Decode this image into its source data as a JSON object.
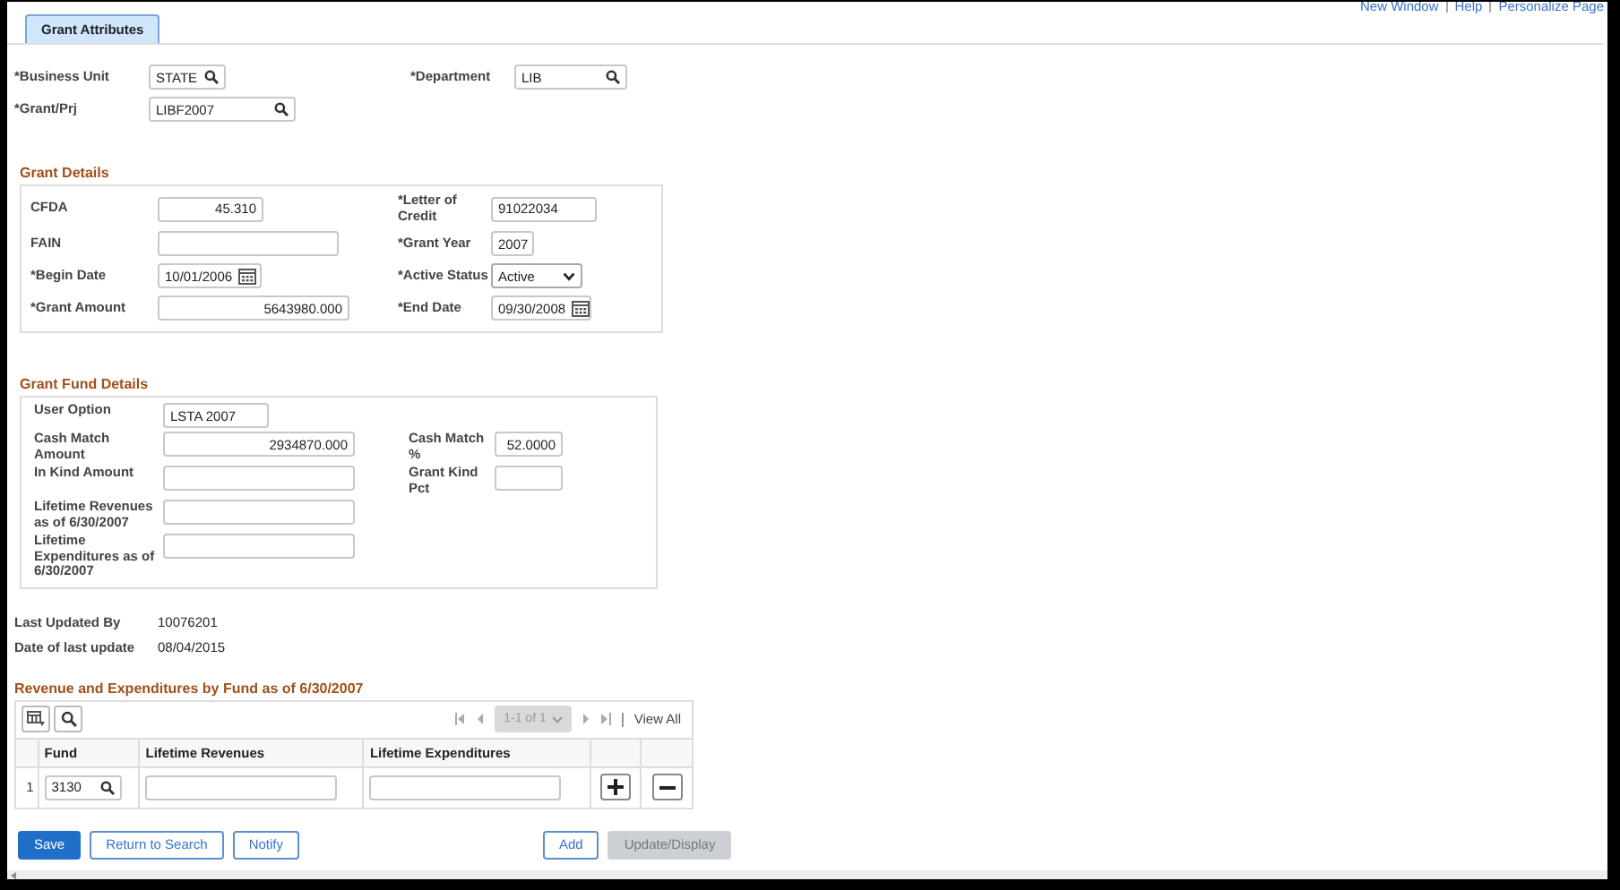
{
  "links": [
    "New Window",
    "Help",
    "Personalize Page"
  ],
  "tabs": [
    {
      "label": "Grant Attributes",
      "selected": true
    }
  ],
  "header_fields": [
    {
      "label": "*Business Unit",
      "value": "STATE",
      "kind": "lookup"
    },
    {
      "label": "*Department",
      "value": "LIB",
      "kind": "lookup"
    },
    {
      "label": "*Grant/Prj",
      "value": "LIBF2007",
      "kind": "lookup"
    }
  ],
  "grant_details": {
    "title": "Grant Details",
    "rows": [
      {
        "left": {
          "label": "CFDA",
          "value": "45.310",
          "kind": "number"
        },
        "right": {
          "label": "*Letter of Credit",
          "value": "91022034",
          "kind": "text"
        }
      },
      {
        "left": {
          "label": "FAIN",
          "kind": "text"
        },
        "right": {
          "label": "*Grant Year",
          "value": "2007",
          "kind": "number"
        }
      },
      {
        "left": {
          "label": "*Begin Date",
          "value": "10/01/2006",
          "kind": "date"
        },
        "right": {
          "label": "*Active Status",
          "value": "Active",
          "kind": "select"
        }
      },
      {
        "left": {
          "label": "*Grant Amount",
          "value": "5643980.000",
          "kind": "number"
        },
        "right": {
          "label": "*End Date",
          "value": "09/30/2008",
          "kind": "date"
        }
      }
    ]
  },
  "grant_fund_details": {
    "title": "Grant Fund Details",
    "rows": [
      {
        "left": {
          "label": "User Option",
          "value": "LSTA 2007",
          "kind": "text"
        }
      },
      {
        "left": {
          "label": "Cash Match Amount",
          "value": "2934870.000",
          "kind": "number"
        },
        "right": {
          "label": "Cash Match %",
          "value": "52.0000",
          "kind": "number"
        }
      },
      {
        "left": {
          "label": "In Kind Amount",
          "kind": "number"
        },
        "right": {
          "label": "Grant Kind Pct",
          "kind": "number"
        }
      },
      {
        "left": {
          "label": "Lifetime Revenues as of 6/30/2007",
          "kind": "number"
        }
      },
      {
        "left": {
          "label": "Lifetime Expenditures as of 6/30/2007",
          "kind": "number"
        }
      }
    ]
  },
  "audit": [
    {
      "label": "Last Updated By",
      "value": "10076201"
    },
    {
      "label": "Date of last update",
      "value": "08/04/2015"
    }
  ],
  "fund_grid": {
    "title": "Revenue and Expenditures by Fund as of 6/30/2007",
    "pager": {
      "label": "1-1 of 1",
      "disabled": true
    },
    "view_all": "View All",
    "columns": [
      "Fund",
      "Lifetime Revenues",
      "Lifetime Expenditures"
    ],
    "rows": [
      {
        "number": "1",
        "fund": "3130"
      }
    ]
  },
  "left_buttons": [
    {
      "label": "Save",
      "kind": "primary",
      "disabled": false
    },
    {
      "label": "Return to Search",
      "kind": "secondary",
      "disabled": false
    },
    {
      "label": "Notify",
      "kind": "secondary",
      "disabled": false
    }
  ],
  "right_buttons": [
    {
      "label": "Add",
      "kind": "secondary",
      "disabled": false
    },
    {
      "label": "Update/Display",
      "kind": "secondary",
      "disabled": true
    }
  ]
}
